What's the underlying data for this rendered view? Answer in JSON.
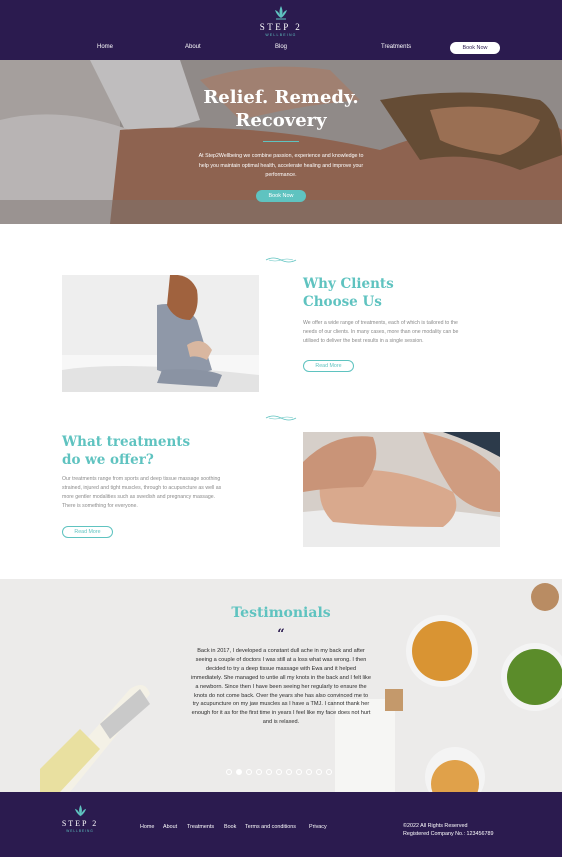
{
  "brand": {
    "name": "STEP 2",
    "tagline": "WELLBEING",
    "colors": {
      "primary": "#2b1b4f",
      "accent": "#5fc3c0",
      "white": "#ffffff"
    }
  },
  "nav": {
    "items": [
      "Home",
      "About",
      "Blog",
      "Treatments"
    ],
    "book_label": "Book Now"
  },
  "hero": {
    "title_line1": "Relief. Remedy.",
    "title_line2": "Recovery",
    "text": "At Step2Wellbeing we combine passion, experience and knowledge to help you maintain optimal health, accelerate healing and improve your performance.",
    "button": "Book Now"
  },
  "why": {
    "title_line1": "Why Clients",
    "title_line2": "Choose Us",
    "text": "We offer a wide range of treatments, each of which is tailored to the needs of our clients. In many cases, more than one modality can be utilised to deliver the best results in a single session.",
    "button": "Read More",
    "image": "woman-back-pain-photo"
  },
  "treatments": {
    "title_line1": "What treatments",
    "title_line2": "do we offer?",
    "text": "Our treatments range from sports and deep tissue massage soothing strained, injured and tight muscles, through to acupuncture as well as more gentler modalities such as swedish and pregnancy massage. There is something for everyone.",
    "button": "Read More",
    "image": "acupuncture-hands-photo"
  },
  "testimonials": {
    "title": "Testimonials",
    "quote_icon": "quote-icon",
    "text": "Back in 2017, I developed a constant dull ache in my back and after seeing a couple of doctors I was still at a loss what was wrong. I then decided to try a deep tissue massage with Ewa and it helped immediately. She managed to untie all my knots in the back and I felt like a newborn. Since then I have been seeing her regularly to ensure the knots do not come back. Over the years she has also convinced me to try acupuncture on my jaw muscles as I have a TMJ. I cannot thank her enough for it as for the first time in years I feel like my face does not hurt and is relaxed.",
    "slide_count": 11,
    "active_slide": 1
  },
  "footer": {
    "links": [
      "Home",
      "About",
      "Treatments",
      "Book",
      "Terms and conditions",
      "Privacy"
    ],
    "copyright": "©2022 All Rights Reserved",
    "company": "Registered Company No.: 123456789"
  }
}
